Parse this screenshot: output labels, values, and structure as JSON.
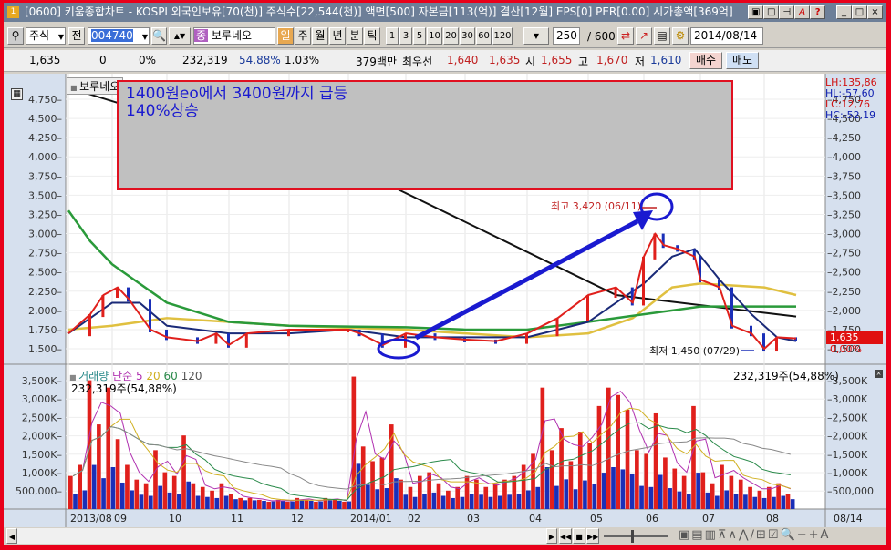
{
  "window": {
    "title": "[0600] 키움종합차트 - KOSPI 외국인보유[70(천)] 주식수[22,544(천)] 액면[500] 자본금[113(억)] 결산[12월] EPS[0] PER[0.00] 시가총액[369억]",
    "icon_label": "1",
    "title_buttons": [
      "▣",
      "□",
      "⊣",
      "A",
      "?"
    ],
    "min": "_",
    "max": "□",
    "close": "×"
  },
  "toolbar": {
    "market": "주식",
    "prev": "전",
    "code": "004740",
    "name_badge": "종",
    "stock_name": "보루네오",
    "periods": [
      "일",
      "주",
      "월",
      "년",
      "분",
      "틱"
    ],
    "intervals": [
      "1",
      "3",
      "5",
      "10",
      "20",
      "30",
      "60",
      "120"
    ],
    "count": "250",
    "total": "/ 600",
    "date": "2014/08/14"
  },
  "info": {
    "price": "1,635",
    "change": "0",
    "change_pct": "0%",
    "volume": "232,319",
    "vol_ratio": "54.88%",
    "turnover": "1.03%",
    "amount": "379백만",
    "best_label": "최우선",
    "ask": "1,640",
    "bid": "1,635",
    "open_label": "시",
    "open": "1,655",
    "high_label": "고",
    "high": "1,670",
    "low_label": "저",
    "low": "1,610",
    "buy": "매수",
    "sell": "매도"
  },
  "legend": {
    "stock": "보루네오",
    "vol_title": "거래량",
    "vol_ma": "단순 5",
    "ma20": "20",
    "ma60": "60",
    "ma120": "120",
    "vol_value": "232,319주(54,88%)",
    "vol_value_right": "232,319주(54,88%)"
  },
  "stats": {
    "lh": "LH:135,86",
    "hl": "HL:-57,60",
    "lc": "LC:12,76",
    "hc": "HC:-52,19"
  },
  "annotation": {
    "line1": "1400원eo에서 3400원까지 급등",
    "line2": "140%상승"
  },
  "markers": {
    "high": "최고 3,420 (06/11)",
    "low": "최저 1,450 (07/29)",
    "current_price": "1,635",
    "current_pct": "0,00%"
  },
  "colors": {
    "up": "#e0201c",
    "down": "#1a2fb8",
    "ma5": "#e0201c",
    "ma20": "#1a2a78",
    "ma60": "#2a9a3a",
    "ma120": "#e0c040",
    "ma240": "#111111",
    "annotation": "#1a1ad0"
  },
  "chart_data": {
    "type": "line",
    "price_axis": {
      "ticks": [
        "4,750",
        "4,500",
        "4,250",
        "4,000",
        "3,750",
        "3,500",
        "3,250",
        "3,000",
        "2,750",
        "2,500",
        "2,250",
        "2,000",
        "1,750",
        "1,500"
      ],
      "range": [
        1400,
        4900
      ]
    },
    "volume_axis": {
      "ticks": [
        "3,500K",
        "3,000K",
        "2,500K",
        "2,000K",
        "1,500K",
        "1,000K",
        "500,000"
      ],
      "range": [
        0,
        3800
      ]
    },
    "x_ticks": [
      "2013/08",
      "09",
      "10",
      "11",
      "12",
      "2014/01",
      "02",
      "03",
      "04",
      "05",
      "06",
      "07",
      "08"
    ],
    "x_end_label": "08/14",
    "x_unit": "months since 2013/08",
    "close": [
      [
        0,
        1700
      ],
      [
        0.5,
        1950
      ],
      [
        0.8,
        2200
      ],
      [
        1.1,
        2300
      ],
      [
        1.3,
        2150
      ],
      [
        1.7,
        1750
      ],
      [
        2.0,
        1650
      ],
      [
        2.5,
        1600
      ],
      [
        2.8,
        1700
      ],
      [
        3.0,
        1550
      ],
      [
        3.3,
        1700
      ],
      [
        4.0,
        1750
      ],
      [
        5.0,
        1750
      ],
      [
        5.2,
        1700
      ],
      [
        5.6,
        1550
      ],
      [
        6.0,
        1700
      ],
      [
        6.5,
        1650
      ],
      [
        7.0,
        1620
      ],
      [
        7.5,
        1600
      ],
      [
        8.0,
        1700
      ],
      [
        8.5,
        1900
      ],
      [
        9.0,
        2200
      ],
      [
        9.5,
        2300
      ],
      [
        9.8,
        2100
      ],
      [
        10.0,
        2700
      ],
      [
        10.2,
        3000
      ],
      [
        10.35,
        2850
      ],
      [
        10.6,
        2800
      ],
      [
        10.9,
        2700
      ],
      [
        11.0,
        2400
      ],
      [
        11.3,
        2300
      ],
      [
        11.5,
        1800
      ],
      [
        11.8,
        1700
      ],
      [
        12.0,
        1500
      ],
      [
        12.2,
        1650
      ],
      [
        12.5,
        1635
      ]
    ],
    "ma20": [
      [
        0,
        1700
      ],
      [
        1,
        2100
      ],
      [
        1.5,
        2100
      ],
      [
        2,
        1800
      ],
      [
        3,
        1700
      ],
      [
        4,
        1700
      ],
      [
        5,
        1750
      ],
      [
        6,
        1650
      ],
      [
        7,
        1650
      ],
      [
        8,
        1650
      ],
      [
        9,
        1850
      ],
      [
        9.5,
        2100
      ],
      [
        10,
        2350
      ],
      [
        10.5,
        2700
      ],
      [
        10.9,
        2800
      ],
      [
        11.3,
        2400
      ],
      [
        11.8,
        1950
      ],
      [
        12.2,
        1650
      ],
      [
        12.5,
        1600
      ]
    ],
    "ma60": [
      [
        0,
        3300
      ],
      [
        0.5,
        2900
      ],
      [
        1,
        2600
      ],
      [
        2,
        2100
      ],
      [
        3,
        1850
      ],
      [
        4,
        1800
      ],
      [
        6,
        1780
      ],
      [
        7,
        1750
      ],
      [
        8,
        1750
      ],
      [
        9,
        1850
      ],
      [
        10,
        1950
      ],
      [
        11,
        2050
      ],
      [
        12.5,
        2050
      ]
    ],
    "ma120": [
      [
        0,
        1750
      ],
      [
        1,
        1800
      ],
      [
        2,
        1900
      ],
      [
        3,
        1850
      ],
      [
        4,
        1800
      ],
      [
        6,
        1750
      ],
      [
        7,
        1700
      ],
      [
        8,
        1650
      ],
      [
        9,
        1700
      ],
      [
        9.8,
        1900
      ],
      [
        10.5,
        2300
      ],
      [
        11,
        2350
      ],
      [
        12,
        2300
      ],
      [
        12.5,
        2200
      ]
    ],
    "ma240": [
      [
        0,
        4900
      ],
      [
        4.5,
        3900
      ],
      [
        5.8,
        3600
      ],
      [
        9.5,
        2200
      ],
      [
        12.5,
        1920
      ]
    ],
    "volume_k": [
      900,
      1200,
      3500,
      2300,
      3300,
      1900,
      1200,
      800,
      700,
      1600,
      1000,
      900,
      2000,
      700,
      600,
      500,
      700,
      400,
      300,
      300,
      250,
      200,
      250,
      200,
      300,
      250,
      200,
      300,
      250,
      200,
      3600,
      1700,
      1300,
      1400,
      2300,
      800,
      600,
      900,
      1000,
      700,
      500,
      600,
      900,
      800,
      600,
      700,
      800,
      900,
      1200,
      1500,
      3300,
      1600,
      2200,
      1300,
      2100,
      1800,
      2800,
      3300,
      3100,
      2700,
      1600,
      1500,
      2600,
      1400,
      1100,
      900,
      2800,
      1000,
      700,
      1200,
      900,
      800,
      600,
      500,
      600,
      700,
      400
    ]
  }
}
